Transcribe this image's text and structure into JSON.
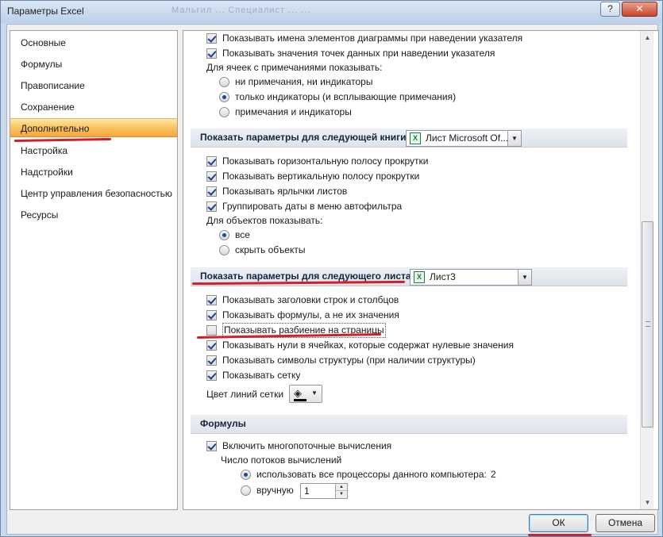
{
  "window": {
    "title": "Параметры Excel",
    "help_label": "?",
    "close_label": "✕",
    "title_faint": "Мальгил   ...   Специалист ...   ..."
  },
  "nav": {
    "items": [
      {
        "label": "Основные"
      },
      {
        "label": "Формулы"
      },
      {
        "label": "Правописание"
      },
      {
        "label": "Сохранение"
      },
      {
        "label": "Дополнительно",
        "selected": true
      },
      {
        "label": "Настройка"
      },
      {
        "label": "Надстройки"
      },
      {
        "label": "Центр управления безопасностью"
      },
      {
        "label": "Ресурсы"
      }
    ]
  },
  "chart_section": {
    "show_element_names": "Показывать имена элементов диаграммы при наведении указателя",
    "show_point_values": "Показывать значения точек данных при наведении указателя",
    "comments_label": "Для ячеек с примечаниями показывать:",
    "comments_options": [
      "ни примечания, ни индикаторы",
      "только индикаторы (и всплывающие примечания)",
      "примечания и индикаторы"
    ]
  },
  "workbook_section": {
    "header": "Показать параметры для следующей книги:",
    "combo_value": "Лист Microsoft Of...",
    "items": [
      "Показывать горизонтальную полосу прокрутки",
      "Показывать вертикальную полосу прокрутки",
      "Показывать ярлычки листов",
      "Группировать даты в меню автофильтра"
    ],
    "objects_label": "Для объектов показывать:",
    "objects_options": [
      "все",
      "скрыть объекты"
    ]
  },
  "sheet_section": {
    "header": "Показать параметры для следующего листа:",
    "combo_value": "Лист3",
    "items": [
      "Показывать заголовки строк и столбцов",
      "Показывать формулы, а не их значения",
      "Показывать разбиение на страницы",
      "Показывать нули в ячейках, которые содержат нулевые значения",
      "Показывать символы структуры (при наличии структуры)",
      "Показывать сетку"
    ],
    "gridline_color_label": "Цвет линий сетки",
    "gridline_color": "#000000"
  },
  "formulas_section": {
    "header": "Формулы",
    "multithread": "Включить многопоточные вычисления",
    "threads_label": "Число потоков вычислений",
    "use_all": "использовать все процессоры данного компьютера:",
    "use_all_count": "2",
    "manual": "вручную",
    "manual_value": "1"
  },
  "footer": {
    "ok_label": "ОК",
    "cancel_label": "Отмена"
  },
  "colors": {
    "annotation_red": "#d0202a",
    "selected_nav": "#f7a53a"
  }
}
